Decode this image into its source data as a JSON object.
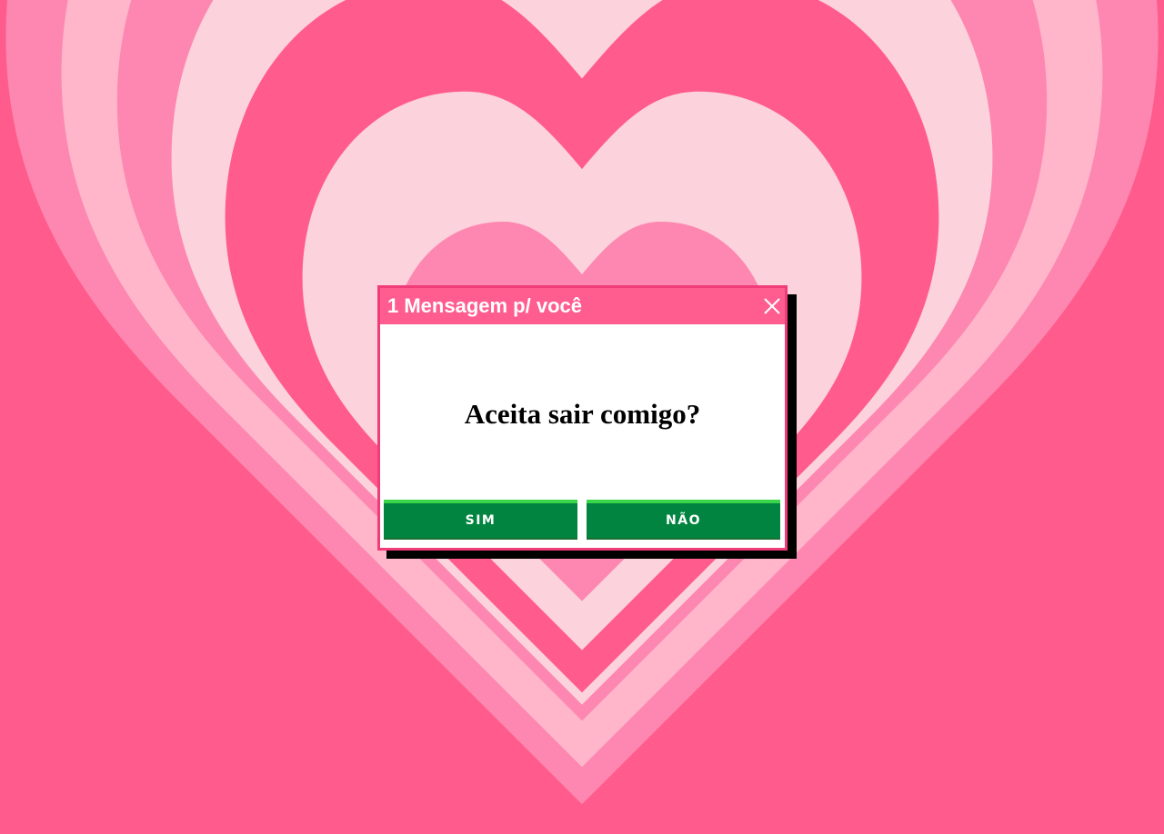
{
  "colors": {
    "bg_dark": "#ff5b8c",
    "bg_mid": "#fd87b0",
    "bg_light": "#ffb6cb",
    "bg_pale": "#fcd2dc",
    "titlebar": "#ff5d8f",
    "border": "#f03d7a",
    "button": "#00843f",
    "button_highlight": "#3ad64a"
  },
  "dialog": {
    "title": "1 Mensagem p/ você",
    "close_icon": "close-icon",
    "message": "Aceita sair comigo?",
    "buttons": {
      "yes_label": "SIM",
      "no_label": "NÃO"
    }
  }
}
